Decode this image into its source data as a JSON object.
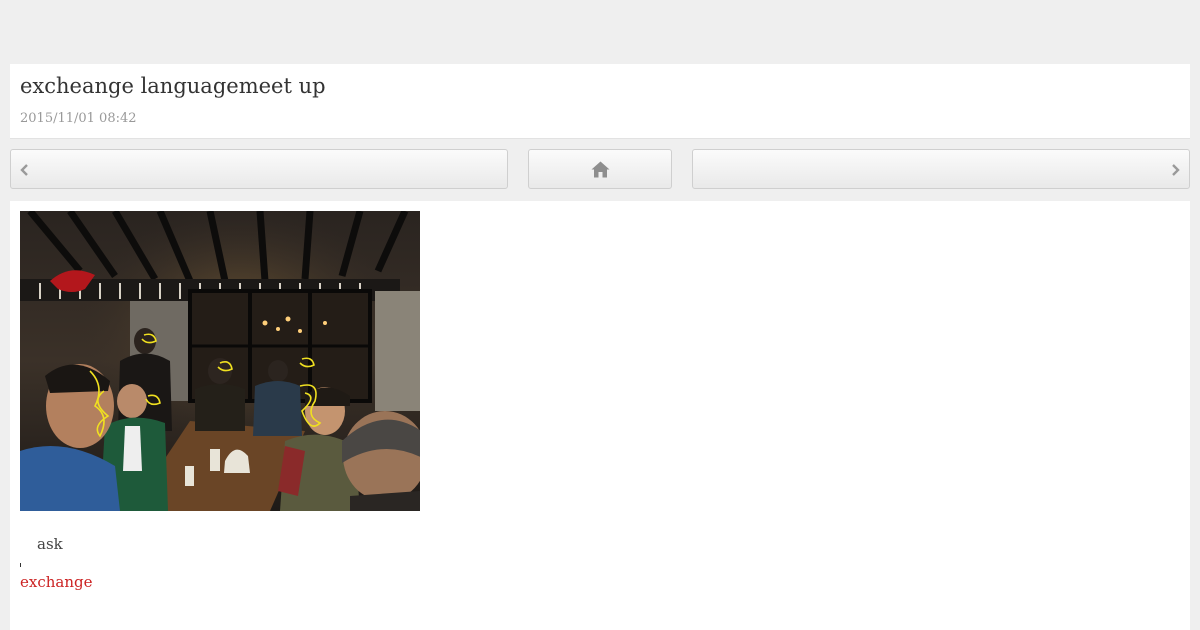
{
  "post": {
    "title": "excheange languagemeet up",
    "date": "2015/11/01 08:42"
  },
  "nav": {
    "prev_icon": "chevron-left-icon",
    "home_icon": "home-icon",
    "next_icon": "chevron-right-icon"
  },
  "content": {
    "photo_icon": "meetup-photo",
    "caption": "ask",
    "tag_link": "exchange"
  },
  "colors": {
    "page_bg": "#efefef",
    "card_bg": "#ffffff",
    "link": "#cc2222",
    "date_text": "#999999"
  }
}
